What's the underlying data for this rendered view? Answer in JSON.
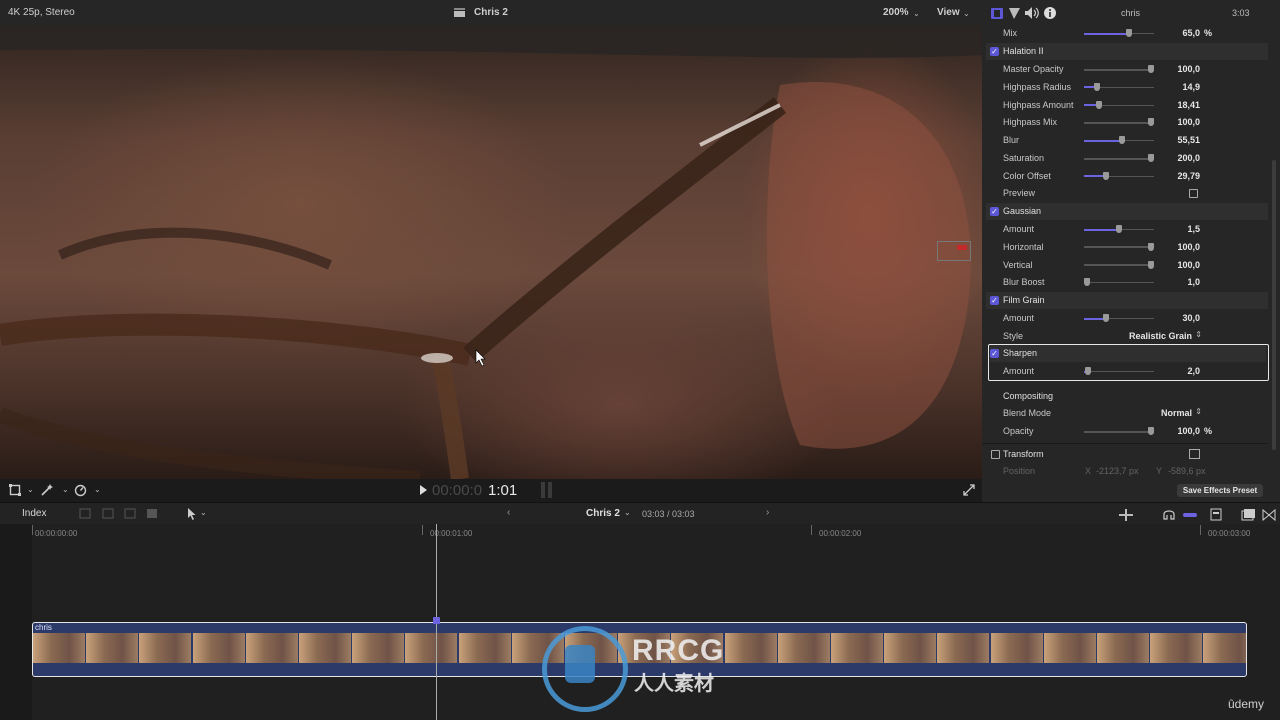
{
  "viewer": {
    "format": "4K 25p, Stereo",
    "clip_title": "Chris 2",
    "zoom": "200%",
    "view_menu": "View",
    "timecode_dim": "00:00:0",
    "timecode_bright": "1:01"
  },
  "inspector": {
    "title": "chris",
    "duration": "3:03",
    "top_row": {
      "label": "Mix",
      "value": "65,0",
      "unit": "%",
      "level": 0.65
    },
    "halation": {
      "name": "Halation II",
      "params": [
        {
          "label": "Master Opacity",
          "value": "100,0",
          "level": 1.0
        },
        {
          "label": "Highpass Radius",
          "value": "14,9",
          "level": 0.15
        },
        {
          "label": "Highpass Amount",
          "value": "18,41",
          "level": 0.18
        },
        {
          "label": "Highpass Mix",
          "value": "100,0",
          "level": 1.0
        },
        {
          "label": "Blur",
          "value": "55,51",
          "level": 0.55
        },
        {
          "label": "Saturation",
          "value": "200,0",
          "level": 1.0
        },
        {
          "label": "Color Offset",
          "value": "29,79",
          "level": 0.3
        }
      ],
      "preview_label": "Preview"
    },
    "gaussian": {
      "name": "Gaussian",
      "params": [
        {
          "label": "Amount",
          "value": "1,5",
          "level": 0.5
        },
        {
          "label": "Horizontal",
          "value": "100,0",
          "level": 1.0
        },
        {
          "label": "Vertical",
          "value": "100,0",
          "level": 1.0
        },
        {
          "label": "Blur Boost",
          "value": "1,0",
          "level": 0.0
        }
      ]
    },
    "film_grain": {
      "name": "Film Grain",
      "amount_label": "Amount",
      "amount_value": "30,0",
      "amount_level": 0.3,
      "style_label": "Style",
      "style_value": "Realistic Grain"
    },
    "sharpen": {
      "name": "Sharpen",
      "amount_label": "Amount",
      "amount_value": "2,0",
      "amount_level": 0.02
    },
    "compositing": {
      "name": "Compositing",
      "blend_label": "Blend Mode",
      "blend_value": "Normal",
      "opacity_label": "Opacity",
      "opacity_value": "100,0",
      "opacity_unit": "%",
      "opacity_level": 1.0
    },
    "transform": {
      "name": "Transform",
      "position_label": "Position",
      "x_label": "X",
      "x_value": "-2123,7 px",
      "y_label": "Y",
      "y_value": "-589,6 px"
    },
    "save_preset": "Save Effects Preset"
  },
  "timeline": {
    "index_label": "Index",
    "project": "Chris 2",
    "position": "03:03 / 03:03",
    "ruler": [
      "00:00:00:00",
      "00:00:01:00",
      "00:00:02:00",
      "00:00:03:00"
    ],
    "clip_name": "chris"
  },
  "watermark": {
    "main": "RRCG",
    "sub": "人人素材",
    "brand": "ûdemy"
  },
  "colors": {
    "accent": "#5b57d6",
    "clip": "#2c3a6a",
    "panel": "#262626"
  }
}
